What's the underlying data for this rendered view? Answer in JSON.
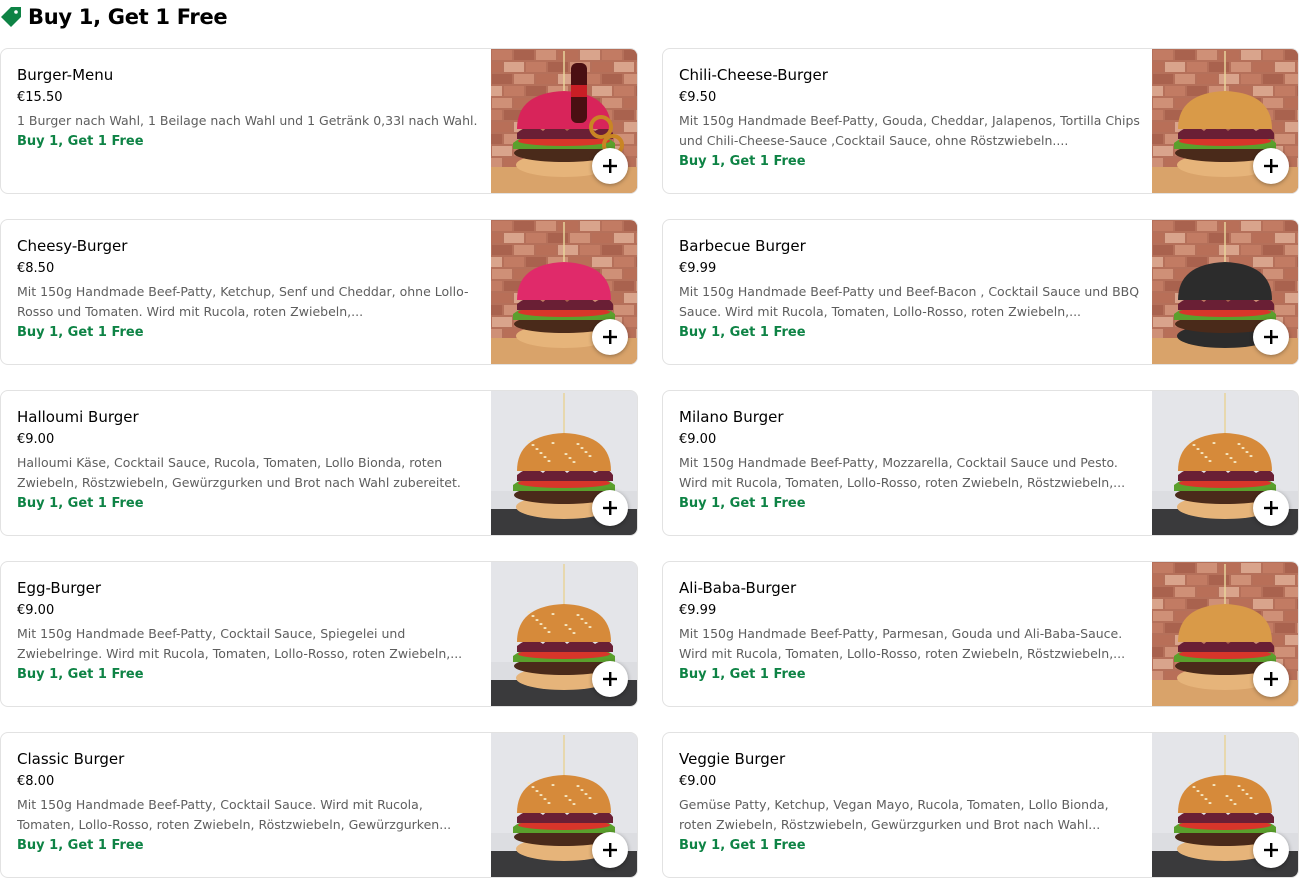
{
  "section": {
    "title": "Buy 1, Get 1 Free",
    "icon": "tag-icon",
    "accent_color": "#0e8345"
  },
  "items": [
    {
      "name": "Burger-Menu",
      "price": "€15.50",
      "description": "1 Burger nach Wahl, 1 Beilage nach Wahl und 1 Getränk 0,33l nach Wahl.",
      "promo": "Buy 1, Get 1 Free",
      "photo": "red-bun-menu-with-cola",
      "bg": "brick",
      "bun": "#d8245a"
    },
    {
      "name": "Chili-Cheese-Burger",
      "price": "€9.50",
      "description": "Mit 150g Handmade Beef-Patty, Gouda, Cheddar, Jalapenos, Tortilla Chips und Chili-Cheese-Sauce ,Cocktail Sauce, ohne Röstzwiebeln....",
      "promo": "Buy 1, Get 1 Free",
      "photo": "classic-bun-burger",
      "bg": "brick",
      "bun": "#d99a48"
    },
    {
      "name": "Cheesy-Burger",
      "price": "€8.50",
      "description": "Mit 150g Handmade Beef-Patty, Ketchup, Senf und Cheddar, ohne Lollo-Rosso und Tomaten. Wird mit Rucola, roten Zwiebeln,...",
      "promo": "Buy 1, Get 1 Free",
      "photo": "pink-bun-burger",
      "bg": "brick",
      "bun": "#e02a6a"
    },
    {
      "name": "Barbecue Burger",
      "price": "€9.99",
      "description": "Mit 150g Handmade Beef-Patty und Beef-Bacon , Cocktail Sauce und BBQ Sauce. Wird mit Rucola, Tomaten, Lollo-Rosso, roten Zwiebeln,...",
      "promo": "Buy 1, Get 1 Free",
      "photo": "black-bun-burger",
      "bg": "brick",
      "bun": "#2c2c2c"
    },
    {
      "name": "Halloumi Burger",
      "price": "€9.00",
      "description": "Halloumi Käse, Cocktail Sauce, Rucola, Tomaten, Lollo Bionda, roten Zwiebeln, Röstzwiebeln, Gewürzgurken und Brot nach Wahl zubereitet.",
      "promo": "Buy 1, Get 1 Free",
      "photo": "sesame-bun-burger",
      "bg": "grey",
      "bun": "#d68a3a"
    },
    {
      "name": "Milano Burger",
      "price": "€9.00",
      "description": "Mit 150g Handmade Beef-Patty, Mozzarella, Cocktail Sauce und Pesto. Wird mit Rucola, Tomaten, Lollo-Rosso, roten Zwiebeln, Röstzwiebeln,...",
      "promo": "Buy 1, Get 1 Free",
      "photo": "sesame-bun-burger",
      "bg": "grey",
      "bun": "#d68a3a"
    },
    {
      "name": "Egg-Burger",
      "price": "€9.00",
      "description": "Mit 150g Handmade Beef-Patty, Cocktail Sauce, Spiegelei und Zwiebelringe. Wird mit Rucola, Tomaten, Lollo-Rosso, roten Zwiebeln,...",
      "promo": "Buy 1, Get 1 Free",
      "photo": "egg-burger",
      "bg": "grey",
      "bun": "#d68a3a"
    },
    {
      "name": "Ali-Baba-Burger",
      "price": "€9.99",
      "description": "Mit 150g Handmade Beef-Patty, Parmesan, Gouda und Ali-Baba-Sauce. Wird mit Rucola, Tomaten, Lollo-Rosso, roten Zwiebeln, Röstzwiebeln,...",
      "promo": "Buy 1, Get 1 Free",
      "photo": "classic-bun-burger",
      "bg": "brick",
      "bun": "#d99a48"
    },
    {
      "name": "Classic Burger",
      "price": "€8.00",
      "description": "Mit 150g Handmade Beef-Patty, Cocktail Sauce. Wird mit Rucola, Tomaten, Lollo-Rosso, roten Zwiebeln, Röstzwiebeln, Gewürzgurken...",
      "promo": "Buy 1, Get 1 Free",
      "photo": "sesame-bun-burger",
      "bg": "grey",
      "bun": "#d68a3a"
    },
    {
      "name": "Veggie Burger",
      "price": "€9.00",
      "description": "Gemüse Patty, Ketchup, Vegan Mayo, Rucola, Tomaten, Lollo Bionda, roten Zwiebeln, Röstzwiebeln, Gewürzgurken und Brot nach Wahl...",
      "promo": "Buy 1, Get 1 Free",
      "photo": "sesame-bun-burger",
      "bg": "grey",
      "bun": "#d68a3a"
    }
  ],
  "add_button_icon": "plus-icon"
}
